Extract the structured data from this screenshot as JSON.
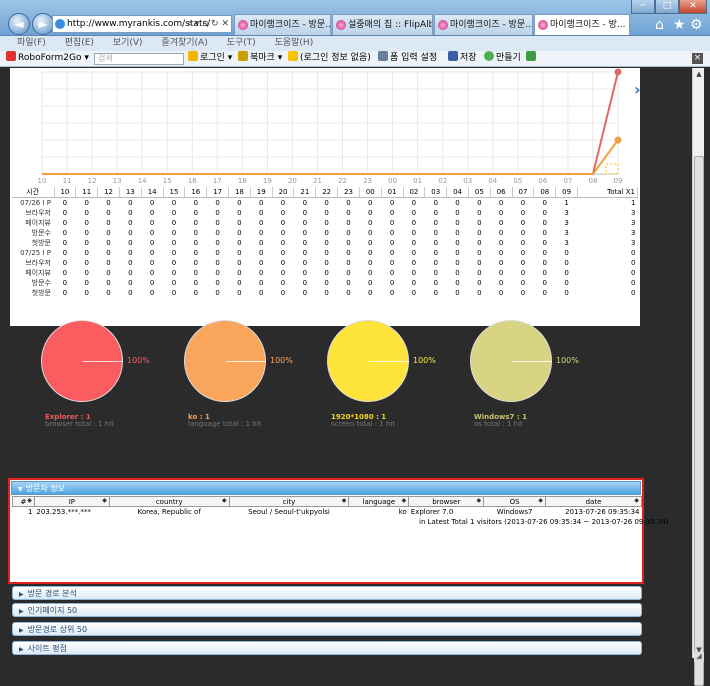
{
  "browser": {
    "address": "http://www.myrankis.com/stats/",
    "address_tools": "⌕ ▾ ▫ ↻ ✕",
    "tabs": [
      {
        "label": "마이랭크이즈 - 방문..."
      },
      {
        "label": "설중매의 집 :: FlipAlb..."
      },
      {
        "label": "마이랭크이즈 - 방문..."
      },
      {
        "label": "마이랭크이즈 - 방..."
      }
    ],
    "window_controls": {
      "minimize": "─",
      "maximize": "□",
      "close": "✕"
    },
    "right_icons": {
      "home": "⌂",
      "favorites": "★",
      "tools": "⚙"
    },
    "menu": [
      "파일(F)",
      "편집(E)",
      "보기(V)",
      "즐겨찾기(A)",
      "도구(T)",
      "도움말(H)"
    ],
    "toolbar": {
      "roboform": "RoboForm2Go",
      "search_placeholder": "검색",
      "login": "로그인",
      "bookmark": "북마크",
      "login_info": "(로그인 정보 없음)",
      "form_settings": "폼 입력 설정",
      "save": "저장",
      "make": "만들기"
    }
  },
  "chart_data": {
    "type": "line",
    "x": [
      "10",
      "11",
      "12",
      "13",
      "14",
      "15",
      "16",
      "17",
      "18",
      "19",
      "20",
      "21",
      "22",
      "23",
      "00",
      "01",
      "02",
      "03",
      "04",
      "05",
      "06",
      "07",
      "08",
      "09"
    ],
    "series": [
      {
        "values": [
          0,
          0,
          0,
          0,
          0,
          0,
          0,
          0,
          0,
          0,
          0,
          0,
          0,
          0,
          0,
          0,
          0,
          0,
          0,
          0,
          0,
          0,
          0,
          3
        ],
        "color": "#e06868"
      },
      {
        "values": [
          0,
          0,
          0,
          0,
          0,
          0,
          0,
          0,
          0,
          0,
          0,
          0,
          0,
          0,
          0,
          0,
          0,
          0,
          0,
          0,
          0,
          0,
          0,
          1
        ],
        "color": "#f0a040"
      }
    ],
    "ylim": [
      0,
      3
    ],
    "grid": true
  },
  "stats": {
    "headers": [
      "시간",
      "10",
      "11",
      "12",
      "13",
      "14",
      "15",
      "16",
      "17",
      "18",
      "19",
      "20",
      "21",
      "22",
      "23",
      "00",
      "01",
      "02",
      "03",
      "04",
      "05",
      "06",
      "07",
      "08",
      "09",
      "Total X1"
    ],
    "rows": [
      {
        "label": "07/26 I P",
        "cells": [
          "0",
          "0",
          "0",
          "0",
          "0",
          "0",
          "0",
          "0",
          "0",
          "0",
          "0",
          "0",
          "0",
          "0",
          "0",
          "0",
          "0",
          "0",
          "0",
          "0",
          "0",
          "0",
          "0",
          "1",
          "1"
        ]
      },
      {
        "label": "브라우저",
        "cells": [
          "0",
          "0",
          "0",
          "0",
          "0",
          "0",
          "0",
          "0",
          "0",
          "0",
          "0",
          "0",
          "0",
          "0",
          "0",
          "0",
          "0",
          "0",
          "0",
          "0",
          "0",
          "0",
          "0",
          "3",
          "3"
        ]
      },
      {
        "label": "페이지뷰",
        "cells": [
          "0",
          "0",
          "0",
          "0",
          "0",
          "0",
          "0",
          "0",
          "0",
          "0",
          "0",
          "0",
          "0",
          "0",
          "0",
          "0",
          "0",
          "0",
          "0",
          "0",
          "0",
          "0",
          "0",
          "3",
          "3"
        ]
      },
      {
        "label": "방문수",
        "cells": [
          "0",
          "0",
          "0",
          "0",
          "0",
          "0",
          "0",
          "0",
          "0",
          "0",
          "0",
          "0",
          "0",
          "0",
          "0",
          "0",
          "0",
          "0",
          "0",
          "0",
          "0",
          "0",
          "0",
          "3",
          "3"
        ]
      },
      {
        "label": "첫방문",
        "cells": [
          "0",
          "0",
          "0",
          "0",
          "0",
          "0",
          "0",
          "0",
          "0",
          "0",
          "0",
          "0",
          "0",
          "0",
          "0",
          "0",
          "0",
          "0",
          "0",
          "0",
          "0",
          "0",
          "0",
          "3",
          "3"
        ]
      },
      {
        "label": "07/25 I P",
        "cells": [
          "0",
          "0",
          "0",
          "0",
          "0",
          "0",
          "0",
          "0",
          "0",
          "0",
          "0",
          "0",
          "0",
          "0",
          "0",
          "0",
          "0",
          "0",
          "0",
          "0",
          "0",
          "0",
          "0",
          "0",
          "0"
        ]
      },
      {
        "label": "브라우저",
        "cells": [
          "0",
          "0",
          "0",
          "0",
          "0",
          "0",
          "0",
          "0",
          "0",
          "0",
          "0",
          "0",
          "0",
          "0",
          "0",
          "0",
          "0",
          "0",
          "0",
          "0",
          "0",
          "0",
          "0",
          "0",
          "0"
        ]
      },
      {
        "label": "페이지뷰",
        "cells": [
          "0",
          "0",
          "0",
          "0",
          "0",
          "0",
          "0",
          "0",
          "0",
          "0",
          "0",
          "0",
          "0",
          "0",
          "0",
          "0",
          "0",
          "0",
          "0",
          "0",
          "0",
          "0",
          "0",
          "0",
          "0"
        ]
      },
      {
        "label": "방문수",
        "cells": [
          "0",
          "0",
          "0",
          "0",
          "0",
          "0",
          "0",
          "0",
          "0",
          "0",
          "0",
          "0",
          "0",
          "0",
          "0",
          "0",
          "0",
          "0",
          "0",
          "0",
          "0",
          "0",
          "0",
          "0",
          "0"
        ]
      },
      {
        "label": "첫방문",
        "cells": [
          "0",
          "0",
          "0",
          "0",
          "0",
          "0",
          "0",
          "0",
          "0",
          "0",
          "0",
          "0",
          "0",
          "0",
          "0",
          "0",
          "0",
          "0",
          "0",
          "0",
          "0",
          "0",
          "0",
          "0",
          "0"
        ]
      }
    ]
  },
  "pies": [
    {
      "percent": "100%",
      "label": "Explorer : 1",
      "total": "browser total : 1 hit",
      "color": "#fa5c5f",
      "label_color": "#f05a5a"
    },
    {
      "percent": "100%",
      "label": "ko : 1",
      "total": "language total : 1 hit",
      "color": "#f9a55c",
      "label_color": "#f5a050"
    },
    {
      "percent": "100%",
      "label": "1920*1080 : 1",
      "total": "screen total : 1 hit",
      "color": "#fde33a",
      "label_color": "#f4d41e"
    },
    {
      "percent": "100%",
      "label": "Windows7 : 1",
      "total": "os total : 1 hit",
      "color": "#d8d483",
      "label_color": "#c8c46a"
    }
  ],
  "visitor": {
    "title": "방문자 정보",
    "headers": [
      "#",
      "IP",
      "country",
      "city",
      "language",
      "browser",
      "OS",
      "date"
    ],
    "rows": [
      {
        "num": "1",
        "ip": "203.253.***.***",
        "country": "Korea, Republic of",
        "city": "Seoul / Seoul-t'ukpyolsi",
        "language": "ko",
        "browser": "Explorer 7.0",
        "os": "Windows7",
        "date": "2013-07-26 09:35:34"
      }
    ],
    "summary": "in Latest Total 1 visitors (2013-07-26 09:35:34 ~ 2013-07-26 09:35:34)"
  },
  "sections": [
    "방문 경로 분석",
    "인기페이지 50",
    "방문경로 상위 50",
    "사이트 평점"
  ]
}
